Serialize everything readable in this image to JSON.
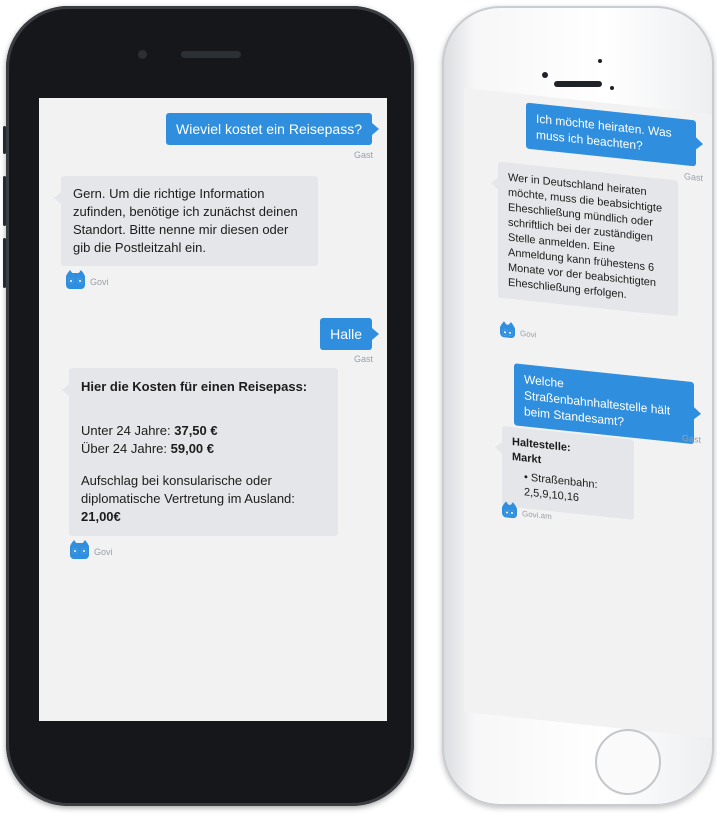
{
  "phone1": {
    "messages": {
      "user1": "Wieviel kostet ein Reisepass?",
      "user1_sender": "Gast",
      "bot1": "Gern. Um die richtige Information zufinden, benötige ich zunächst deinen Standort. Bitte nenne mir diesen oder gib die Postleitzahl ein.",
      "bot1_sender": "Govi",
      "user2": "Halle",
      "user2_sender": "Gast",
      "bot2_title": "Hier die Kosten für einen Reisepass:",
      "bot2_line1_label": "Unter 24 Jahre:",
      "bot2_line1_value": "37,50 €",
      "bot2_line2_label": "Über 24 Jahre:",
      "bot2_line2_value": "59,00 €",
      "bot2_line3_label": "Aufschlag bei konsularische oder diplomatische Vertretung im Ausland:",
      "bot2_line3_value": "21,00€",
      "bot2_sender": "Govi"
    }
  },
  "phone2": {
    "messages": {
      "user1": "Ich möchte heiraten. Was muss ich beachten?",
      "user1_sender": "Gast",
      "bot1": "Wer in Deutschland heiraten möchte, muss die beabsichtigte Eheschließung mündlich oder schriftlich bei der zuständigen Stelle anmelden. Eine Anmeldung kann frühestens 6 Monate vor der beabsichtigten Eheschließung erfolgen.",
      "bot1_sender": "Govi",
      "user2": "Welche Straßenbahnhaltestelle hält beim Standesamt?",
      "user2_sender": "Gast",
      "bot2_title1": "Haltestelle:",
      "bot2_title2": "Markt",
      "bot2_item": "Straßenbahn: 2,5,9,10,16",
      "bot2_sender": "Govi.am"
    }
  },
  "colors": {
    "accent": "#2f8fde",
    "bot_bubble": "#e4e6e9",
    "screen_bg": "#f2f2f3",
    "phone1_body": "#15171a",
    "phone2_body": "#ffffff"
  },
  "icons": {
    "bot_avatar": "owl-icon"
  }
}
